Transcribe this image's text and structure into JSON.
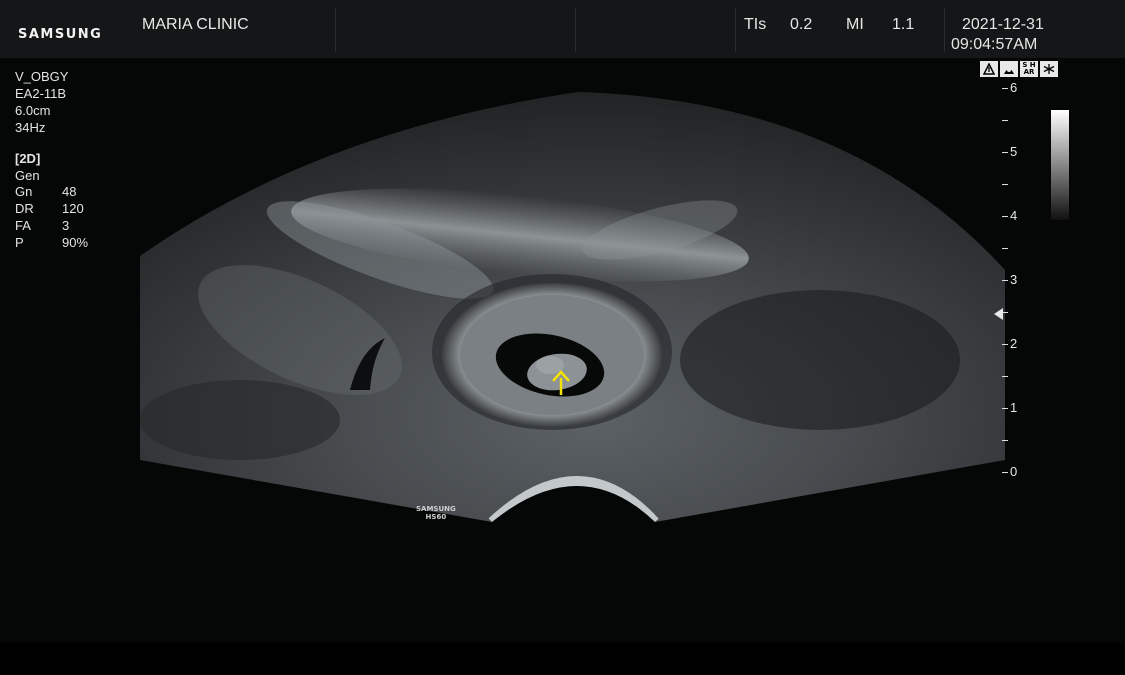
{
  "header": {
    "brand": "SAMSUNG",
    "clinic": "MARIA CLINIC",
    "tis_label": "TIs",
    "tis_value": "0.2",
    "mi_label": "MI",
    "mi_value": "1.1",
    "date": "2021-12-31",
    "time": "09:04:57AM"
  },
  "params": {
    "preset": "V_OBGY",
    "probe": "EA2-11B",
    "depth": "6.0cm",
    "frame_rate": "34Hz"
  },
  "imaging": {
    "mode": "[2D]",
    "profile": "Gen",
    "rows": [
      {
        "key": "Gn",
        "value": "48"
      },
      {
        "key": "DR",
        "value": "120"
      },
      {
        "key": "FA",
        "value": "3"
      },
      {
        "key": "P",
        "value": "90%"
      }
    ]
  },
  "status_icons": [
    "tissue-harmonic-icon",
    "scan-icon",
    "s-har-icon",
    "freeze-icon"
  ],
  "status_icon_labels": [
    "",
    "",
    "S HAR",
    ""
  ],
  "depth_scale": {
    "labels": [
      "6",
      "5",
      "4",
      "3",
      "2",
      "1",
      "0"
    ],
    "unit": "cm"
  },
  "probe_tag": {
    "line1": "SAMSUNG",
    "line2": "HS60"
  },
  "annotation": {
    "arrow_color": "#f5e400"
  }
}
